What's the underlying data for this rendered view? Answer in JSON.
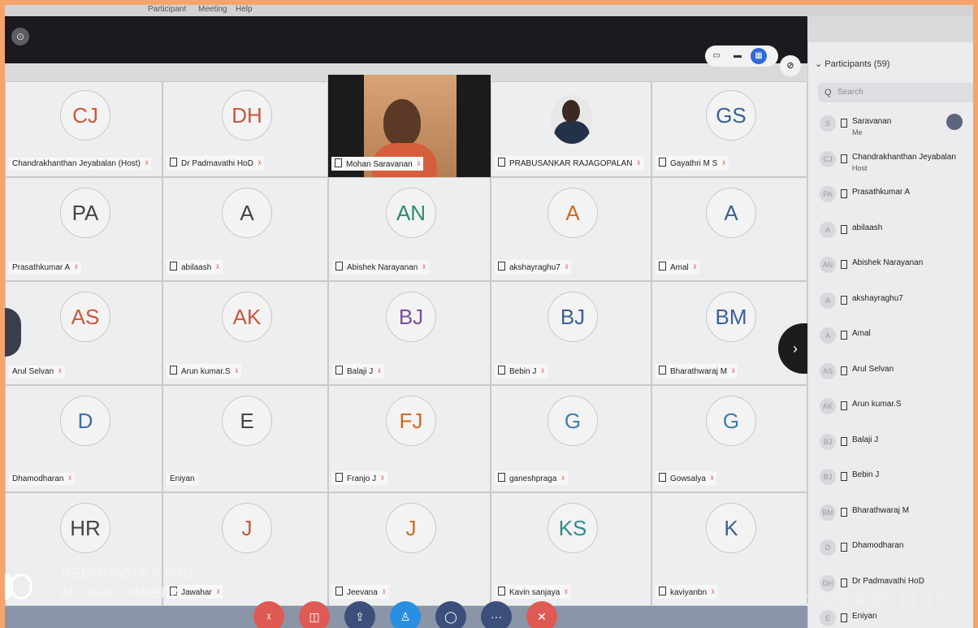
{
  "menu": {
    "item1": "Participant",
    "item2": "Meeting",
    "item3": "Help"
  },
  "topbar": {
    "info_icon": "info-icon"
  },
  "view_buttons": [
    "speaker-view-icon",
    "gallery-view-icon",
    "grid-view-icon",
    "popout-icon"
  ],
  "tiles": [
    {
      "initials": "CJ",
      "name": "Chandrakhanthan Jeyabalan (Host)",
      "color": "#c8573d"
    },
    {
      "initials": "DH",
      "name": "Dr Padmavathi HoD",
      "color": "#c8573d"
    },
    {
      "name": "Mohan Saravanan",
      "video": true
    },
    {
      "name": "PRABUSANKAR RAJAGOPALAN",
      "photo": true
    },
    {
      "initials": "GS",
      "name": "Gayathri M S",
      "color": "#3b5f96"
    },
    {
      "initials": "PA",
      "name": "Prasathkumar A",
      "color": "#444444"
    },
    {
      "initials": "A",
      "name": "abilaash",
      "color": "#444444"
    },
    {
      "initials": "AN",
      "name": "Abishek Narayanan",
      "color": "#2e8b6e"
    },
    {
      "initials": "A",
      "name": "akshayraghu7",
      "color": "#d2691e"
    },
    {
      "initials": "A",
      "name": "Amal",
      "color": "#3b5f96"
    },
    {
      "initials": "AS",
      "name": "Arul Selvan",
      "color": "#c8573d"
    },
    {
      "initials": "AK",
      "name": "Arun kumar.S",
      "color": "#c8573d"
    },
    {
      "initials": "BJ",
      "name": "Balaji J",
      "color": "#7a4fa0"
    },
    {
      "initials": "BJ",
      "name": "Bebin J",
      "color": "#3b5f96"
    },
    {
      "initials": "BM",
      "name": "Bharathwaraj M",
      "color": "#3b5f96"
    },
    {
      "initials": "D",
      "name": "Dhamodharan",
      "color": "#3b6fa8"
    },
    {
      "initials": "E",
      "name": "Eniyan",
      "color": "#444444"
    },
    {
      "initials": "FJ",
      "name": "Franjo J",
      "color": "#d2691e"
    },
    {
      "initials": "G",
      "name": "ganeshpraga",
      "color": "#3b7fa8"
    },
    {
      "initials": "G",
      "name": "Gowsalya",
      "color": "#3b7fa8"
    },
    {
      "initials": "HR",
      "name": "",
      "color": "#444444"
    },
    {
      "initials": "J",
      "name": "Jawahar",
      "color": "#c8573d"
    },
    {
      "initials": "J",
      "name": "Jeevana",
      "color": "#d2691e"
    },
    {
      "initials": "KS",
      "name": "Kavin sanjaya",
      "color": "#2e8b8b"
    },
    {
      "initials": "K",
      "name": "kaviyanbn",
      "color": "#3b5f96"
    }
  ],
  "participants_panel": {
    "title": "Participants (59)",
    "search_placeholder": "Search",
    "items": [
      {
        "avatar": "S",
        "name": "Saravanan",
        "sub": "Me"
      },
      {
        "avatar": "CJ",
        "name": "Chandrakhanthan Jeyabalan",
        "sub": "Host"
      },
      {
        "avatar": "PA",
        "name": "Prasathkumar A",
        "sub": ""
      },
      {
        "avatar": "A",
        "name": "abilaash",
        "sub": ""
      },
      {
        "avatar": "AN",
        "name": "Abishek Narayanan",
        "sub": ""
      },
      {
        "avatar": "A",
        "name": "akshayraghu7",
        "sub": ""
      },
      {
        "avatar": "A",
        "name": "Amal",
        "sub": ""
      },
      {
        "avatar": "AS",
        "name": "Arul Selvan",
        "sub": ""
      },
      {
        "avatar": "AK",
        "name": "Arun kumar.S",
        "sub": ""
      },
      {
        "avatar": "BJ",
        "name": "Balaji J",
        "sub": ""
      },
      {
        "avatar": "BJ",
        "name": "Bebin J",
        "sub": ""
      },
      {
        "avatar": "BM",
        "name": "Bharathwaraj M",
        "sub": ""
      },
      {
        "avatar": "D",
        "name": "Dhamodharan",
        "sub": ""
      },
      {
        "avatar": "DH",
        "name": "Dr Padmavathi HoD",
        "sub": ""
      },
      {
        "avatar": "E",
        "name": "Eniyan",
        "sub": ""
      }
    ]
  },
  "toolbar": {
    "buttons": [
      {
        "icon": "mic-muted-icon",
        "color": "#e05a55"
      },
      {
        "icon": "video-off-icon",
        "color": "#e05a55"
      },
      {
        "icon": "share-icon",
        "color": "#3b4f7a"
      },
      {
        "icon": "participants-icon",
        "color": "#2a8fe0"
      },
      {
        "icon": "chat-icon",
        "color": "#3b4f7a"
      },
      {
        "icon": "more-icon",
        "color": "#3b4f7a"
      },
      {
        "icon": "leave-icon",
        "color": "#e05a55"
      }
    ]
  },
  "watermark": {
    "line1": "REDMI NOTE 6 PRO",
    "line2": "MI DUAL CAMERA"
  },
  "timestamp": "2020/4/25  11:17"
}
